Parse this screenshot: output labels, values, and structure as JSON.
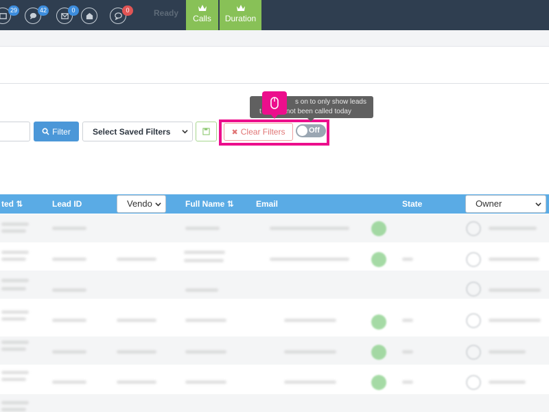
{
  "topbar": {
    "icons": [
      {
        "name": "inbox-icon",
        "badge": "29",
        "badge_color": "#3d8ddd"
      },
      {
        "name": "chat-icon",
        "badge": "42",
        "badge_color": "#3d8ddd"
      },
      {
        "name": "mail-icon",
        "badge": "0",
        "badge_color": "#3d8ddd"
      },
      {
        "name": "open-mail-icon",
        "badge": "",
        "badge_color": ""
      },
      {
        "name": "comment-icon",
        "badge": "0",
        "badge_color": "#e05555"
      }
    ],
    "status": "Ready",
    "calls_label": "Calls",
    "duration_label": "Duration"
  },
  "filters": {
    "filter_button": "Filter",
    "saved_filters": "Select Saved Filters",
    "clear_filters": "Clear Filters",
    "toggle_label": "Off",
    "toggle_state": "off"
  },
  "tooltip": {
    "line1": "s on to only show leads",
    "line2": "t          e not been called today"
  },
  "table": {
    "columns": {
      "created": "ted",
      "lead_id": "Lead ID",
      "vendor": "Vendo",
      "full_name": "Full Name",
      "email": "Email",
      "state": "State",
      "owner": "Owner"
    },
    "sort_glyph": "⇅"
  },
  "colors": {
    "topbar": "#2f3e50",
    "accent_green": "#88c157",
    "table_header": "#5aabe5",
    "highlight": "#ec0e8c"
  }
}
